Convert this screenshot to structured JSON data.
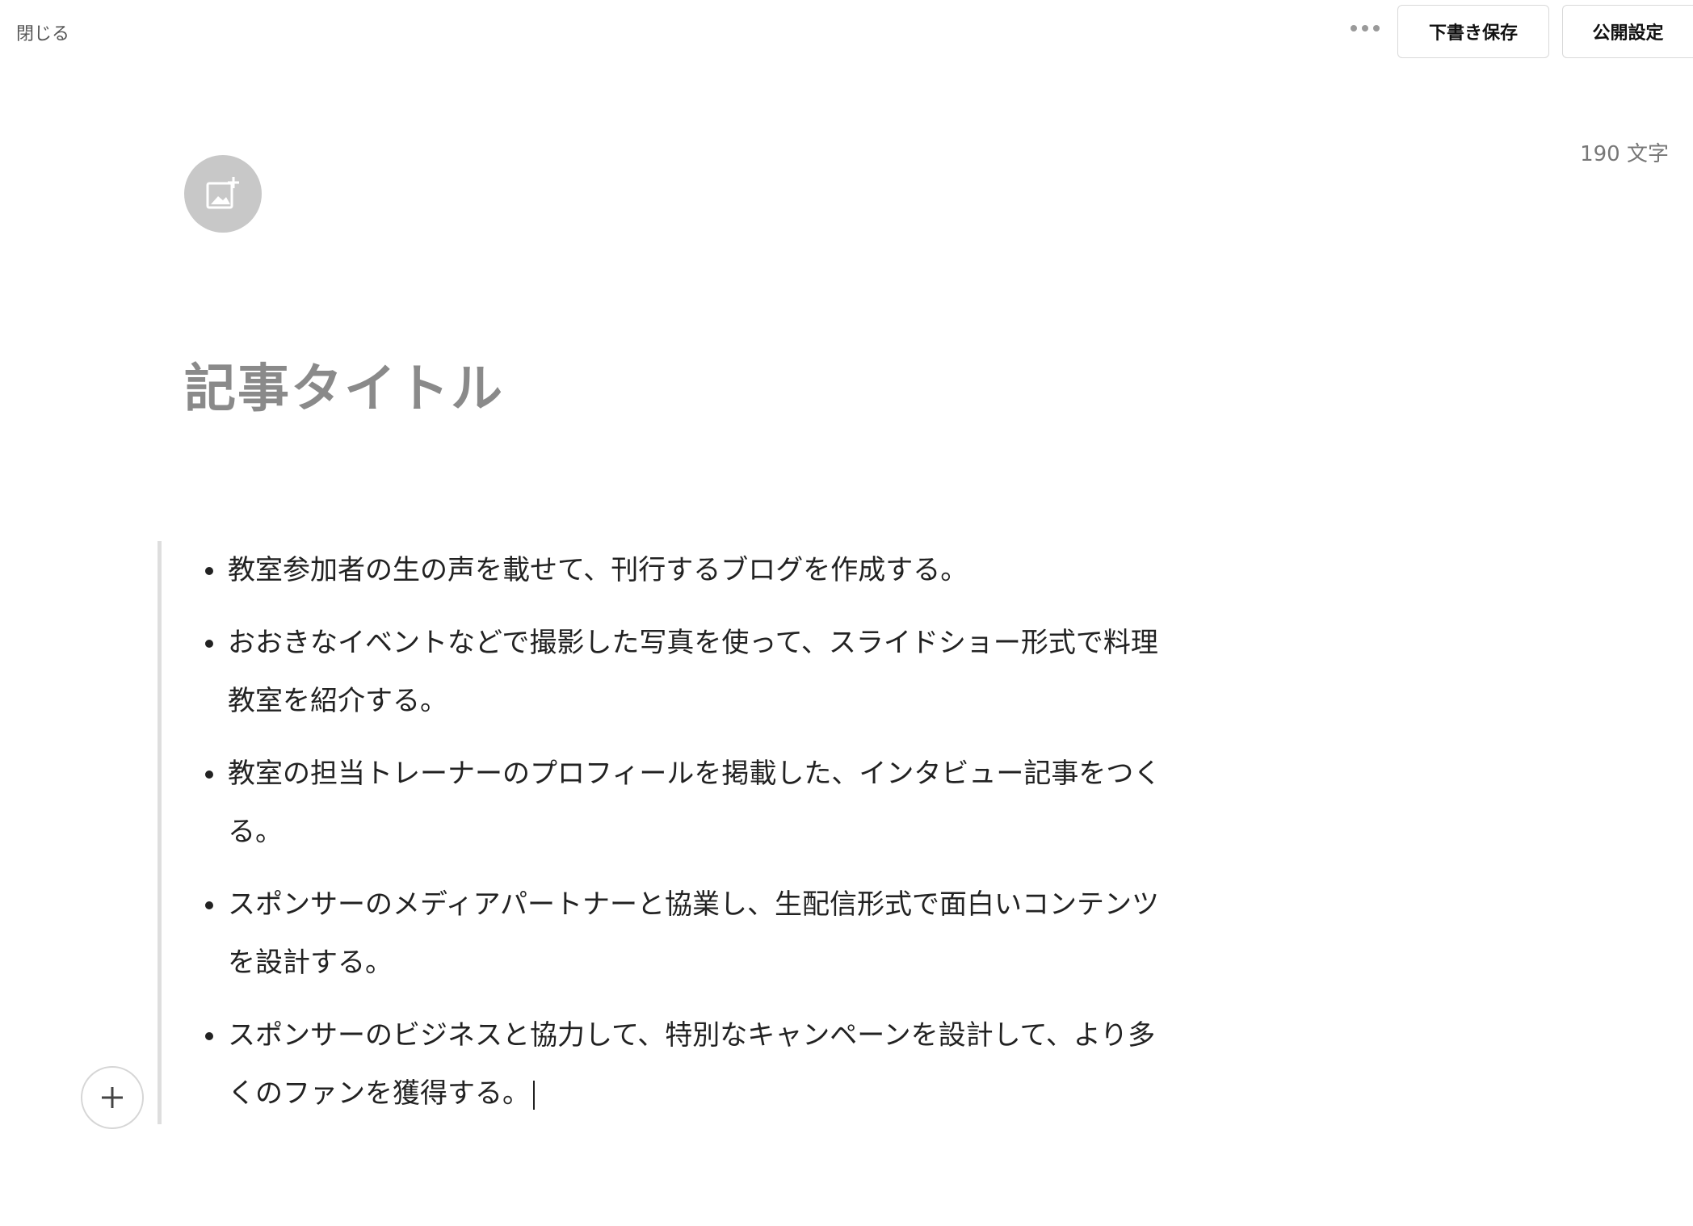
{
  "header": {
    "close_label": "閉じる",
    "more_icon": "more-horizontal-icon",
    "draft_save_label": "下書き保存",
    "publish_settings_label": "公開設定"
  },
  "editor": {
    "char_count": "190 文字",
    "add_image_icon": "add-image-icon",
    "title_placeholder": "記事タイトル",
    "bullets": [
      "教室参加者の生の声を載せて、刊行するブログを作成する。",
      "おおきなイベントなどで撮影した写真を使って、スライドショー形式で料理教室を紹介する。",
      "教室の担当トレーナーのプロフィールを掲載した、インタビュー記事をつくる。",
      "スポンサーのメディアパートナーと協業し、生配信形式で面白いコンテンツを設計する。",
      "スポンサーのビジネスと協力して、特別なキャンペーンを設計して、より多くのファンを獲得する。"
    ],
    "add_block_icon": "plus-icon"
  },
  "colors": {
    "title_placeholder": "#8a8a8a",
    "border": "#dedede",
    "icon_bg": "#c8c8c8"
  }
}
